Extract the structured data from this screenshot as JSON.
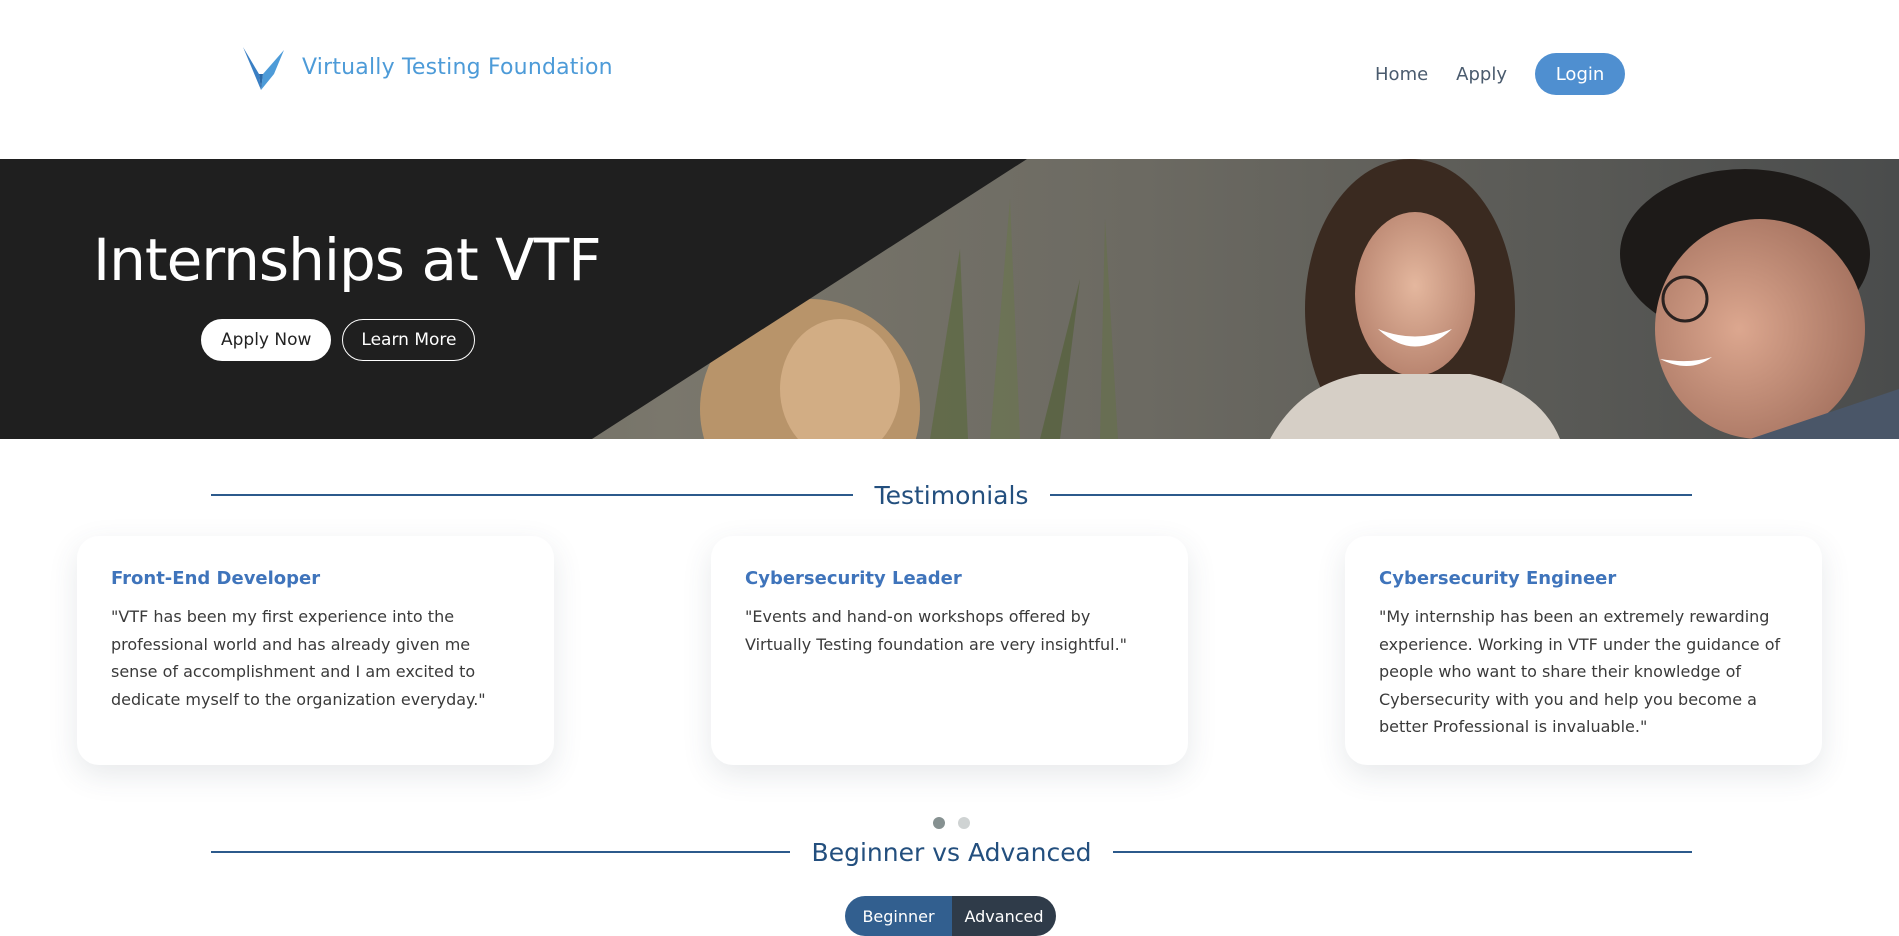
{
  "header": {
    "logo_icon": "v-bird-logo",
    "brand_name": "Virtually Testing Foundation",
    "brand_color": "#4d9bd8",
    "nav": {
      "home_label": "Home",
      "apply_label": "Apply",
      "login_label": "Login"
    },
    "accent_color": "#4f8fd0"
  },
  "hero": {
    "title": "Internships at VTF",
    "apply_now_label": "Apply Now",
    "learn_more_label": "Learn More"
  },
  "testimonials": {
    "title": "Testimonials",
    "cards": [
      {
        "role": "Front-End Developer",
        "quote": "\"VTF has been my first experience into the professional world and has already given me sense of accomplishment and I am excited to dedicate myself to the organization everyday.\""
      },
      {
        "role": "Cybersecurity Leader",
        "quote": "\"Events and hand-on workshops offered by Virtually Testing foundation are very insightful.\""
      },
      {
        "role": "Cybersecurity Engineer",
        "quote": "\"My internship has been an extremely rewarding experience. Working in VTF under the guidance of people who want to share their knowledge of Cybersecurity with you and help you become a better Professional is invaluable.\""
      }
    ],
    "pages": 2,
    "active_page": 1
  },
  "beginner_vs_advanced": {
    "title": "Beginner vs Advanced",
    "beginner_label": "Beginner",
    "advanced_label": "Advanced",
    "selected": "Beginner"
  }
}
